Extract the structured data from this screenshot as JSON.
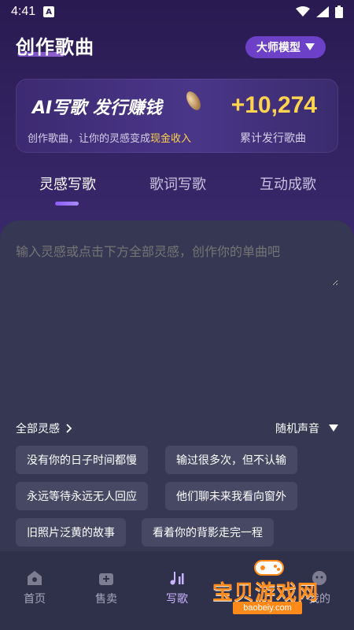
{
  "status_bar": {
    "time": "4:41",
    "a_icon": "A"
  },
  "header": {
    "title": "创作歌曲",
    "model_select": "大师模型"
  },
  "banner": {
    "title": "AI写歌 发行赚钱",
    "subtitle_prefix": "创作歌曲，让你的灵感变成",
    "subtitle_highlight": "现金收入",
    "amount": "+10,274",
    "amount_label": "累计发行歌曲"
  },
  "tabs": [
    "灵感写歌",
    "歌词写歌",
    "互动成歌"
  ],
  "editor": {
    "placeholder": "输入灵感或点击下方全部灵感，创作你的单曲吧",
    "all_inspirations": "全部灵感",
    "voice_select": "随机声音"
  },
  "chips": [
    "没有你的日子时间都慢",
    "输过很多次，但不认输",
    "永远等待永远无人回应",
    "他们聊未来我看向窗外",
    "旧照片泛黄的故事",
    "看着你的背影走完一程"
  ],
  "tabbar": [
    "首页",
    "售卖",
    "写歌",
    "我的"
  ],
  "watermark": {
    "text": "宝贝游戏网",
    "url": "baobeiy.com"
  },
  "colors": {
    "accent": "#8b5cf6",
    "highlight": "#ffd34d",
    "active_nav": "#c9b5ff"
  }
}
